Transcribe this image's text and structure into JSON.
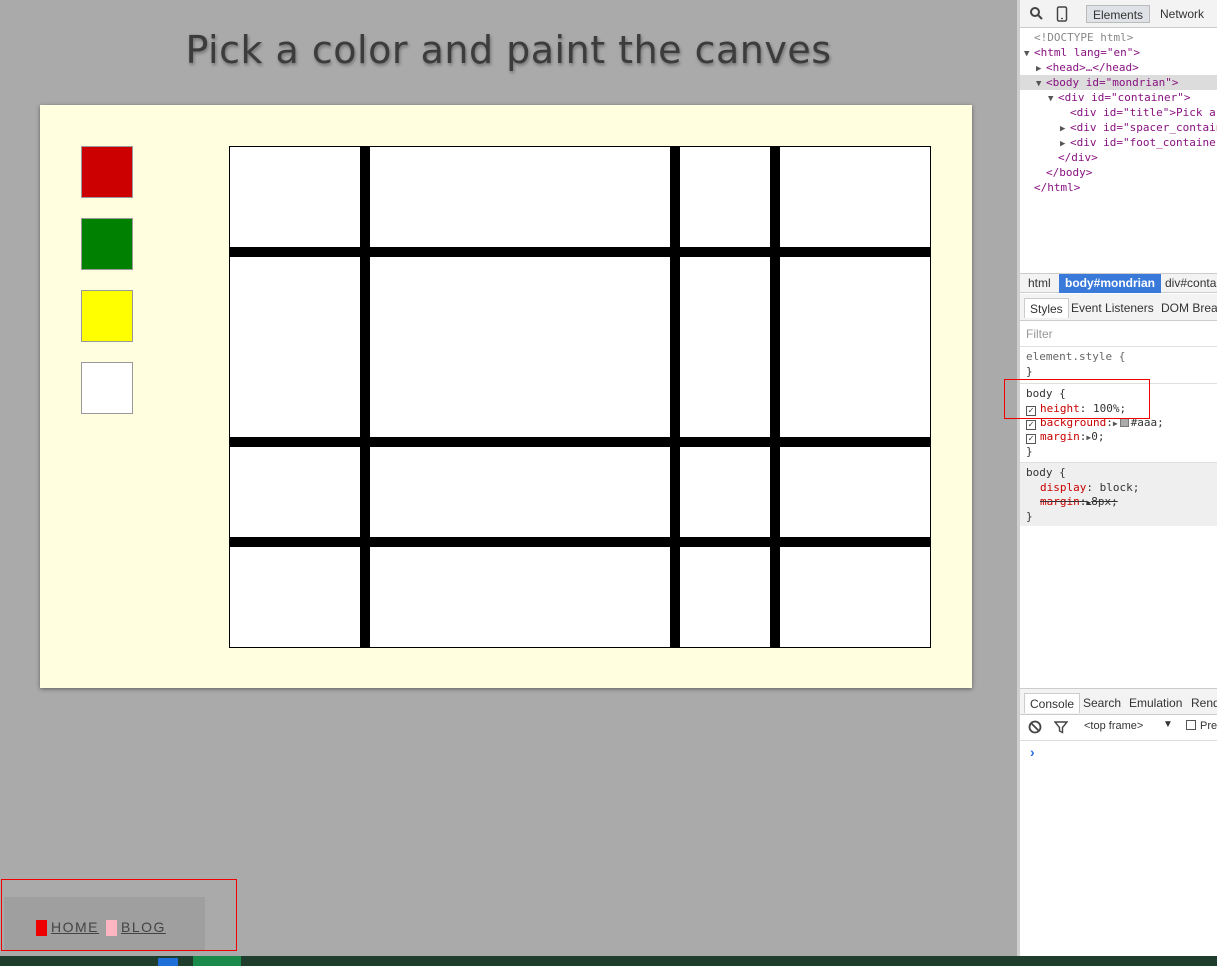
{
  "page": {
    "title": "Pick a color and paint the canves",
    "background": "#aaa",
    "board_color": "#ffffe0"
  },
  "palette": [
    {
      "name": "red",
      "color": "#cc0000"
    },
    {
      "name": "green",
      "color": "#008000"
    },
    {
      "name": "yellow",
      "color": "#ffff00"
    },
    {
      "name": "white",
      "color": "#ffffff"
    }
  ],
  "footer": {
    "links": [
      {
        "label": "HOME",
        "marker_color": "#ee0000"
      },
      {
        "label": "BLOG",
        "marker_color": "#ffb6c1"
      }
    ]
  },
  "devtools": {
    "toolbar": {
      "search_icon": "search-icon",
      "device_icon": "mobile-device-icon",
      "tabs": [
        "Elements",
        "Network"
      ]
    },
    "dom": {
      "doctype": "<!DOCTYPE html>",
      "html_open": "<html lang=\"en\">",
      "head": "<head>…</head>",
      "body_open": "<body id=\"mondrian\">",
      "container_open": "<div id=\"container\">",
      "title_div": "<div id=\"title\">Pick a",
      "spacer_div": "<div id=\"spacer_contain",
      "foot_div": "<div id=\"foot_container",
      "div_close": "</div>",
      "body_close": "</body>",
      "html_close": "</html>"
    },
    "breadcrumbs": [
      "html",
      "body#mondrian",
      "div#conta"
    ],
    "styles_tabs": [
      "Styles",
      "Event Listeners",
      "DOM Breal"
    ],
    "filter_placeholder": "Filter",
    "rules": {
      "element_style": "element.style {",
      "close": "}",
      "body_selector": "body {",
      "height_prop": "height",
      "height_val": "100%;",
      "background_prop": "background",
      "background_val": "#aaa;",
      "margin_prop": "margin",
      "margin_val": "0;",
      "display_prop": "display",
      "display_val": "block;",
      "ua_margin_prop": "margin",
      "ua_margin_val": "8px;"
    },
    "console_tabs": [
      "Console",
      "Search",
      "Emulation",
      "Rend"
    ],
    "console_bar": {
      "frame": "<top frame>",
      "preserve": "Pre"
    },
    "prompt": "›"
  }
}
